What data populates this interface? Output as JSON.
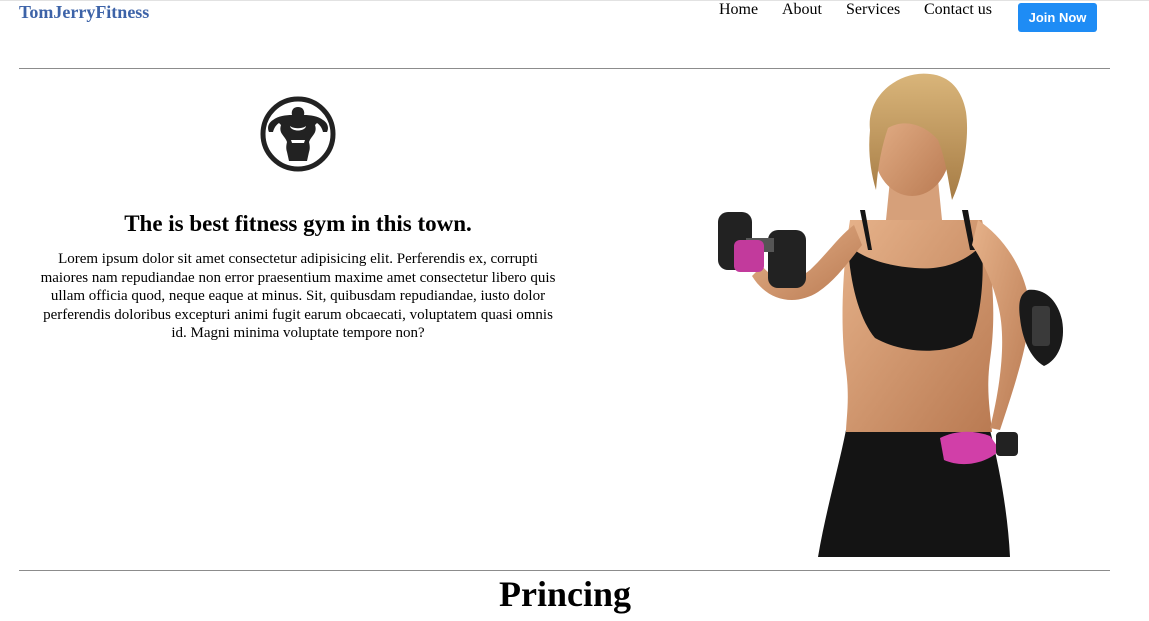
{
  "header": {
    "brand": "TomJerryFitness",
    "nav": [
      "Home",
      "About",
      "Services",
      "Contact us"
    ],
    "cta_label": "Join Now"
  },
  "hero": {
    "logo_icon": "bodybuilder-emblem-icon",
    "title": "The is best fitness gym in this town.",
    "text": "Lorem ipsum dolor sit amet consectetur adipisicing elit. Perferendis ex, corrupti maiores nam repudiandae non error praesentium maxime amet consectetur libero quis ullam officia quod, neque eaque at minus. Sit, quibusdam repudiandae, iusto dolor perferendis doloribus excepturi animi fugit earum obcaecati, voluptatem quasi omnis id. Magni minima voluptate tempore non?",
    "image": "fitness-woman-with-dumbbell-photo"
  },
  "section": {
    "title": "Princing"
  },
  "colors": {
    "brand": "#3d63a8",
    "button": "#1e8cf5",
    "divider": "#8c8c8c"
  }
}
